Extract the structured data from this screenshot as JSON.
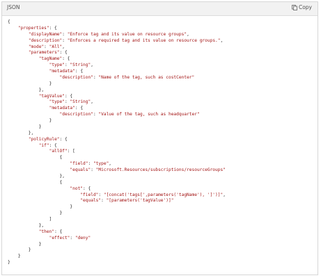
{
  "header": {
    "language_label": "JSON",
    "copy_label": "Copy",
    "copy_icon": "copy-icon"
  },
  "code_lines": [
    [
      {
        "t": "p",
        "v": "{"
      }
    ],
    [
      {
        "t": "p",
        "v": "    "
      },
      {
        "t": "k",
        "v": "\"properties\""
      },
      {
        "t": "p",
        "v": ": {"
      }
    ],
    [
      {
        "t": "p",
        "v": "        "
      },
      {
        "t": "k",
        "v": "\"displayName\""
      },
      {
        "t": "p",
        "v": ": "
      },
      {
        "t": "s",
        "v": "\"Enforce tag and its value on resource groups\""
      },
      {
        "t": "p",
        "v": ","
      }
    ],
    [
      {
        "t": "p",
        "v": "        "
      },
      {
        "t": "k",
        "v": "\"description\""
      },
      {
        "t": "p",
        "v": ": "
      },
      {
        "t": "s",
        "v": "\"Enforces a required tag and its value on resource groups.\""
      },
      {
        "t": "p",
        "v": ","
      }
    ],
    [
      {
        "t": "p",
        "v": "        "
      },
      {
        "t": "k",
        "v": "\"mode\""
      },
      {
        "t": "p",
        "v": ": "
      },
      {
        "t": "s",
        "v": "\"All\""
      },
      {
        "t": "p",
        "v": ","
      }
    ],
    [
      {
        "t": "p",
        "v": "        "
      },
      {
        "t": "k",
        "v": "\"parameters\""
      },
      {
        "t": "p",
        "v": ": {"
      }
    ],
    [
      {
        "t": "p",
        "v": "            "
      },
      {
        "t": "k",
        "v": "\"tagName\""
      },
      {
        "t": "p",
        "v": ": {"
      }
    ],
    [
      {
        "t": "p",
        "v": "                "
      },
      {
        "t": "k",
        "v": "\"type\""
      },
      {
        "t": "p",
        "v": ": "
      },
      {
        "t": "s",
        "v": "\"String\""
      },
      {
        "t": "p",
        "v": ","
      }
    ],
    [
      {
        "t": "p",
        "v": "                "
      },
      {
        "t": "k",
        "v": "\"metadata\""
      },
      {
        "t": "p",
        "v": ": {"
      }
    ],
    [
      {
        "t": "p",
        "v": "                    "
      },
      {
        "t": "k",
        "v": "\"description\""
      },
      {
        "t": "p",
        "v": ": "
      },
      {
        "t": "s",
        "v": "\"Name of the tag, such as costCenter\""
      }
    ],
    [
      {
        "t": "p",
        "v": "                }"
      }
    ],
    [
      {
        "t": "p",
        "v": "            },"
      }
    ],
    [
      {
        "t": "p",
        "v": "            "
      },
      {
        "t": "k",
        "v": "\"tagValue\""
      },
      {
        "t": "p",
        "v": ": {"
      }
    ],
    [
      {
        "t": "p",
        "v": "                "
      },
      {
        "t": "k",
        "v": "\"type\""
      },
      {
        "t": "p",
        "v": ": "
      },
      {
        "t": "s",
        "v": "\"String\""
      },
      {
        "t": "p",
        "v": ","
      }
    ],
    [
      {
        "t": "p",
        "v": "                "
      },
      {
        "t": "k",
        "v": "\"metadata\""
      },
      {
        "t": "p",
        "v": ": {"
      }
    ],
    [
      {
        "t": "p",
        "v": "                    "
      },
      {
        "t": "k",
        "v": "\"description\""
      },
      {
        "t": "p",
        "v": ": "
      },
      {
        "t": "s",
        "v": "\"Value of the tag, such as headquarter\""
      }
    ],
    [
      {
        "t": "p",
        "v": "                }"
      }
    ],
    [
      {
        "t": "p",
        "v": "            }"
      }
    ],
    [
      {
        "t": "p",
        "v": "        },"
      }
    ],
    [
      {
        "t": "p",
        "v": "        "
      },
      {
        "t": "k",
        "v": "\"policyRule\""
      },
      {
        "t": "p",
        "v": ": {"
      }
    ],
    [
      {
        "t": "p",
        "v": "            "
      },
      {
        "t": "k",
        "v": "\"if\""
      },
      {
        "t": "p",
        "v": ": {"
      }
    ],
    [
      {
        "t": "p",
        "v": "                "
      },
      {
        "t": "k",
        "v": "\"allOf\""
      },
      {
        "t": "p",
        "v": ": ["
      }
    ],
    [
      {
        "t": "p",
        "v": "                    {"
      }
    ],
    [
      {
        "t": "p",
        "v": "                        "
      },
      {
        "t": "k",
        "v": "\"field\""
      },
      {
        "t": "p",
        "v": ": "
      },
      {
        "t": "s",
        "v": "\"type\""
      },
      {
        "t": "p",
        "v": ","
      }
    ],
    [
      {
        "t": "p",
        "v": "                        "
      },
      {
        "t": "k",
        "v": "\"equals\""
      },
      {
        "t": "p",
        "v": ": "
      },
      {
        "t": "s",
        "v": "\"Microsoft.Resources/subscriptions/resourceGroups\""
      }
    ],
    [
      {
        "t": "p",
        "v": "                    },"
      }
    ],
    [
      {
        "t": "p",
        "v": "                    {"
      }
    ],
    [
      {
        "t": "p",
        "v": "                        "
      },
      {
        "t": "k",
        "v": "\"not\""
      },
      {
        "t": "p",
        "v": ": {"
      }
    ],
    [
      {
        "t": "p",
        "v": "                            "
      },
      {
        "t": "k",
        "v": "\"field\""
      },
      {
        "t": "p",
        "v": ": "
      },
      {
        "t": "s",
        "v": "\"[concat('tags[',parameters('tagName'), ']')]\""
      },
      {
        "t": "p",
        "v": ","
      }
    ],
    [
      {
        "t": "p",
        "v": "                            "
      },
      {
        "t": "k",
        "v": "\"equals\""
      },
      {
        "t": "p",
        "v": ": "
      },
      {
        "t": "s",
        "v": "\"[parameters('tagValue')]\""
      }
    ],
    [
      {
        "t": "p",
        "v": "                        }"
      }
    ],
    [
      {
        "t": "p",
        "v": "                    }"
      }
    ],
    [
      {
        "t": "p",
        "v": "                ]"
      }
    ],
    [
      {
        "t": "p",
        "v": "            },"
      }
    ],
    [
      {
        "t": "p",
        "v": "            "
      },
      {
        "t": "k",
        "v": "\"then\""
      },
      {
        "t": "p",
        "v": ": {"
      }
    ],
    [
      {
        "t": "p",
        "v": "                "
      },
      {
        "t": "k",
        "v": "\"effect\""
      },
      {
        "t": "p",
        "v": ": "
      },
      {
        "t": "s",
        "v": "\"deny\""
      }
    ],
    [
      {
        "t": "p",
        "v": "            }"
      }
    ],
    [
      {
        "t": "p",
        "v": "        }"
      }
    ],
    [
      {
        "t": "p",
        "v": "    }"
      }
    ],
    [
      {
        "t": "p",
        "v": "}"
      }
    ]
  ]
}
